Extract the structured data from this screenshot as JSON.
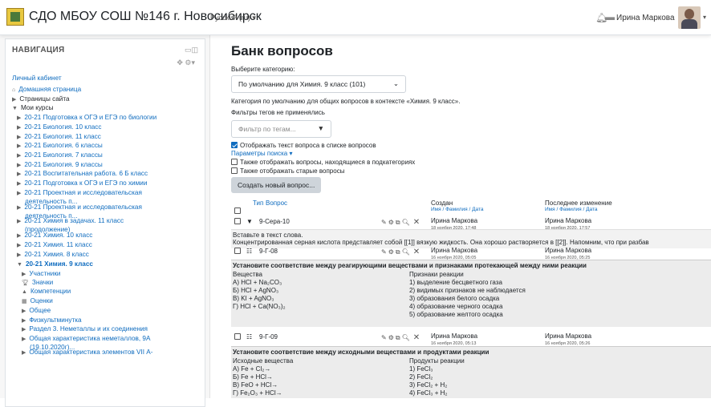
{
  "header": {
    "site_name": "СДО МБОУ СОШ №146 г. Новосибирск",
    "language": "Русский (ru) ▾",
    "user_name": "Ирина Маркова"
  },
  "nav": {
    "title": "НАВИГАЦИЯ",
    "items": [
      {
        "label": "Личный кабинет"
      },
      {
        "label": "Домашняя страница"
      },
      {
        "label": "Страницы сайта"
      },
      {
        "label": "Мои курсы"
      },
      {
        "label": "20-21 Подготовка к ОГЭ и ЕГЭ по биологии"
      },
      {
        "label": "20-21 Биология. 10 класс"
      },
      {
        "label": "20-21 Биология. 11 класс"
      },
      {
        "label": "20-21 Биология. 6 классы"
      },
      {
        "label": "20-21 Биология. 7 классы"
      },
      {
        "label": "20-21 Биология. 9 классы"
      },
      {
        "label": "20-21 Воспитательная работа. 6 Б класс"
      },
      {
        "label": "20-21 Подготовка к ОГЭ и ЕГЭ по химии"
      },
      {
        "label": "20-21 Проектная и исследовательская",
        "label2": "деятельность п..."
      },
      {
        "label": "20-21 Проектная и исследовательская",
        "label2": "деятельность п..."
      },
      {
        "label": "20-21 Химия в задачах. 11 класс",
        "label2": "(продолжение)"
      },
      {
        "label": "20-21 Химия. 10 класс"
      },
      {
        "label": "20-21 Химия. 11 класс"
      },
      {
        "label": "20-21 Химия. 8 класс"
      },
      {
        "label": "20-21 Химия. 9 класс"
      },
      {
        "label": "Участники"
      },
      {
        "label": "Значки"
      },
      {
        "label": "Компетенции"
      },
      {
        "label": "Оценки"
      },
      {
        "label": "Общее"
      },
      {
        "label": "Физкультминутка"
      },
      {
        "label": "Раздел 3. Неметаллы и их соединения"
      },
      {
        "label": "Общая характеристика неметаллов, 9А",
        "label2": "(19.10.2020г)..."
      },
      {
        "label": "Общая характеристика элементов VII А-"
      }
    ]
  },
  "main": {
    "title": "Банк вопросов",
    "choose_category": "Выберите категорию:",
    "category_value": "По умолчанию для Химия. 9 класс (101)",
    "category_desc": "Категория по умолчанию для общих вопросов в контексте «Химия. 9 класс».",
    "tag_filters": "Фильтры тегов не применялись",
    "tag_placeholder": "Фильтр по тегам...",
    "show_text": "Отображать текст вопроса в списке вопросов",
    "search_params": "Параметры поиска ▾",
    "show_subcats": "Также отображать вопросы, находящиеся в подкатегориях",
    "show_old": "Также отображать старые вопросы",
    "create_button": "Создать новый вопрос...",
    "table": {
      "col_type": "Тип",
      "col_question": "Вопрос",
      "col_created": "Создан",
      "col_created_sub": "Имя / Фамилия / Дата",
      "col_modified": "Последнее изменение",
      "col_modified_sub": "Имя / Фамилия / Дата"
    },
    "questions": [
      {
        "name": "9-Сера-10",
        "created_by": "Ирина Маркова",
        "created_date": "18 ноября 2020, 17:48",
        "modified_by": "Ирина Маркова",
        "modified_date": "18 ноября 2020, 17:57",
        "text1": "Вставьте в текст слова.",
        "text2": "Концентрированная серная кислота представляет собой [[1]] вязкую жидкость. Она хорошо растворяется в [[2]]. Напомним, что при разбав"
      },
      {
        "name": "9-Г-08",
        "created_by": "Ирина Маркова",
        "created_date": "16 ноября 2020, 05:05",
        "modified_by": "Ирина Маркова",
        "modified_date": "16 ноября 2020, 05:25",
        "heading": "Установите соответствие между реагирующими веществами и признаками протекающей между ними реакции",
        "left_header": "Вещества",
        "left": [
          "А) HCl + Na₂CO₃",
          "Б) HCl + AgNO₃",
          "В) KI + AgNO₃",
          "Г) HCl + Ca(NO₃)₂"
        ],
        "right_header": "Признаки реакции",
        "right": [
          "1) выделение бесцветного газа",
          "2) видимых признаков не наблюдается",
          "3) образования белого осадка",
          "4) образование черного осадка",
          "5) образование желтого осадка"
        ]
      },
      {
        "name": "9-Г-09",
        "created_by": "Ирина Маркова",
        "created_date": "16 ноября 2020, 05:13",
        "modified_by": "Ирина Маркова",
        "modified_date": "16 ноября 2020, 05:26",
        "heading": "Установите соответствие между исходными веществами и продуктами реакции",
        "left_header": "Исходные вещества",
        "left": [
          "А) Fe + Cl₂→",
          "Б) Fe + HCl→",
          "В) FeO + HCl→",
          "Г) Fe₂O₃ + HCl→"
        ],
        "right_header": "Продукты реакции",
        "right": [
          "1) FeCl₃",
          "2) FeCl₂",
          "3) FeCl₂ + H₂",
          "4) FeCl₃ + H₂"
        ]
      }
    ]
  }
}
